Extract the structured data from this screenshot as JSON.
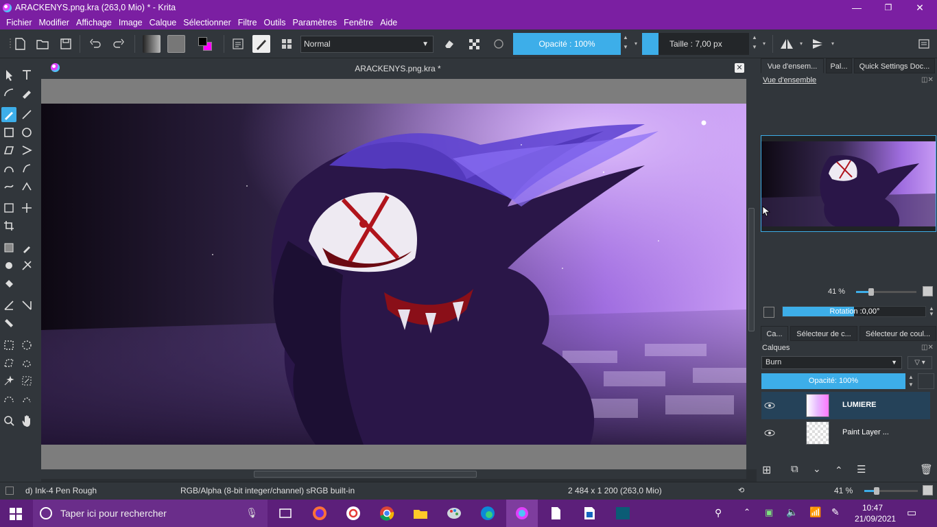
{
  "window": {
    "title": "ARACKENYS.png.kra (263,0 Mio)  * - Krita",
    "minimize": "—",
    "restore": "❐",
    "close": "✕"
  },
  "menu": [
    "Fichier",
    "Modifier",
    "Affichage",
    "Image",
    "Calque",
    "Sélectionner",
    "Filtre",
    "Outils",
    "Paramètres",
    "Fenêtre",
    "Aide"
  ],
  "toolbar": {
    "blend_mode": "Normal",
    "opacity_label": "Opacité : 100%",
    "size_label": "Taille :  7,00 px",
    "fg_color": "#000000",
    "bg_color": "#ff00ff"
  },
  "document": {
    "tab_title": "ARACKENYS.png.kra *",
    "close": "✕"
  },
  "dock": {
    "top_tabs": [
      "Vue d'ensem...",
      "Pal...",
      "Quick Settings Doc..."
    ],
    "overview_title": "Vue d'ensemble",
    "zoom": "41 %",
    "rotation_label": "Rotation :0,00°",
    "bottom_tabs": [
      "Ca...",
      "Sélecteur de c...",
      "Sélecteur de coul..."
    ],
    "layers_title": "Calques",
    "layer_blend": "Burn",
    "layer_opacity": "Opacité:  100%",
    "layers": [
      {
        "name": "LUMIERE",
        "selected": true
      },
      {
        "name": "Paint Layer ...",
        "selected": false
      }
    ],
    "bottom_zoom": "41 %"
  },
  "status": {
    "brush": "d) Ink-4 Pen Rough",
    "colorspace": "RGB/Alpha (8-bit integer/channel)  sRGB built-in",
    "dimensions": "2 484 x 1 200 (263,0 Mio)"
  },
  "taskbar": {
    "search_placeholder": "Taper ici pour rechercher",
    "time": "10:47",
    "date": "21/09/2021"
  },
  "colors": {
    "accent": "#3daee9",
    "titlebar": "#7b1fa2",
    "panel": "#31363b",
    "taskbar": "#5c1f7a"
  }
}
